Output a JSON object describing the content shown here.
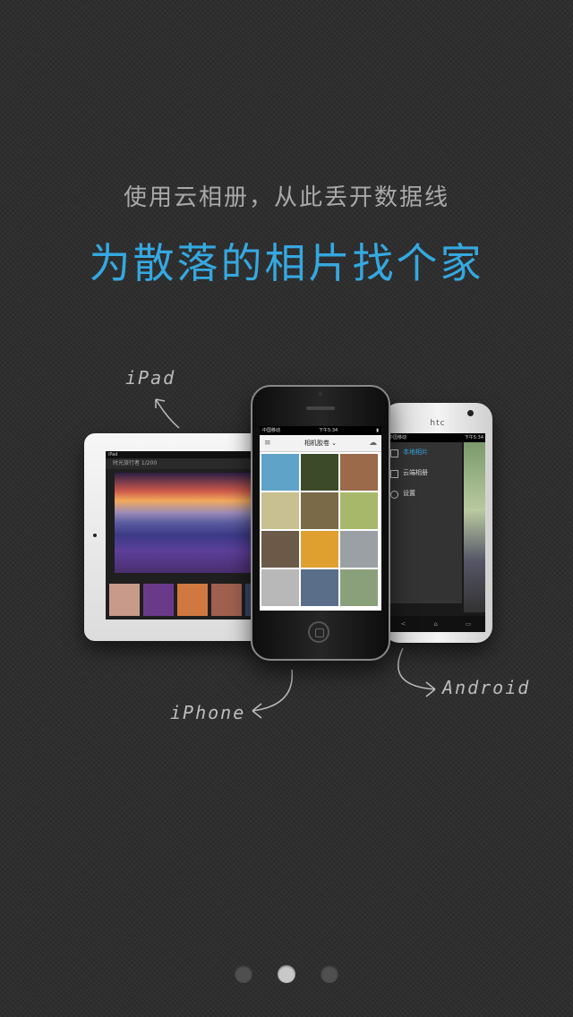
{
  "intro": {
    "subtitle": "使用云相册，从此丢开数据线",
    "headline": "为散落的相片找个家"
  },
  "labels": {
    "ipad": "iPad",
    "iphone": "iPhone",
    "android": "Android"
  },
  "android_device": {
    "brand": "htc",
    "status_left": "中国移动",
    "status_right": "下午5:34",
    "menu": [
      {
        "label": "本地相片",
        "active": true
      },
      {
        "label": "云端相册",
        "active": false
      },
      {
        "label": "设置",
        "active": false
      }
    ],
    "nav": [
      "<",
      "⌂",
      "▭"
    ]
  },
  "iphone_device": {
    "status_left": "中国移动",
    "status_center": "下午5:34",
    "nav_title": "相机胶卷",
    "thumb_colors": [
      "#5fa3c9",
      "#3d4a2a",
      "#9a6a4a",
      "#c8c090",
      "#7b6a48",
      "#a8b86a",
      "#6b5a48",
      "#e0a030",
      "#9aa0a4",
      "#b8b8b8",
      "#5a6e8a",
      "#8aa07a"
    ]
  },
  "ipad_device": {
    "status": "iPad",
    "bar_text": "时光旅行者 1/200",
    "thumb_colors": [
      "#c89a8a",
      "#6a3a8a",
      "#d07840",
      "#a06050",
      "#3a4a6a"
    ]
  },
  "pager": {
    "count": 3,
    "active_index": 1
  },
  "colors": {
    "accent": "#35a8e0",
    "subtitle": "#a9a9a9",
    "background": "#2c2c2c"
  }
}
